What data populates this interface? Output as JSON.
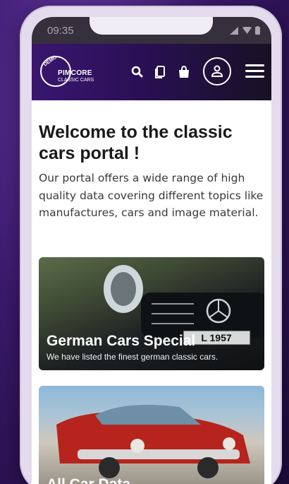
{
  "status_bar": {
    "time": "09:35"
  },
  "header": {
    "logo_badge": "DEMO",
    "logo_brand": "PIMCORE",
    "logo_subtitle": "CLASSIC CARS"
  },
  "main": {
    "title": "Welcome to the classic cars portal !",
    "intro": "Our portal offers a wide range of high quality data covering different topics like manufactures, cars and image material."
  },
  "cards": [
    {
      "title": "German Cars Special",
      "subtitle": "We have listed the finest german classic cars.",
      "plate": "L 1957"
    },
    {
      "title": "All Car Data"
    }
  ],
  "colors": {
    "header_start": "#3a1670",
    "header_end": "#171124",
    "background": "#3b1a6e"
  }
}
